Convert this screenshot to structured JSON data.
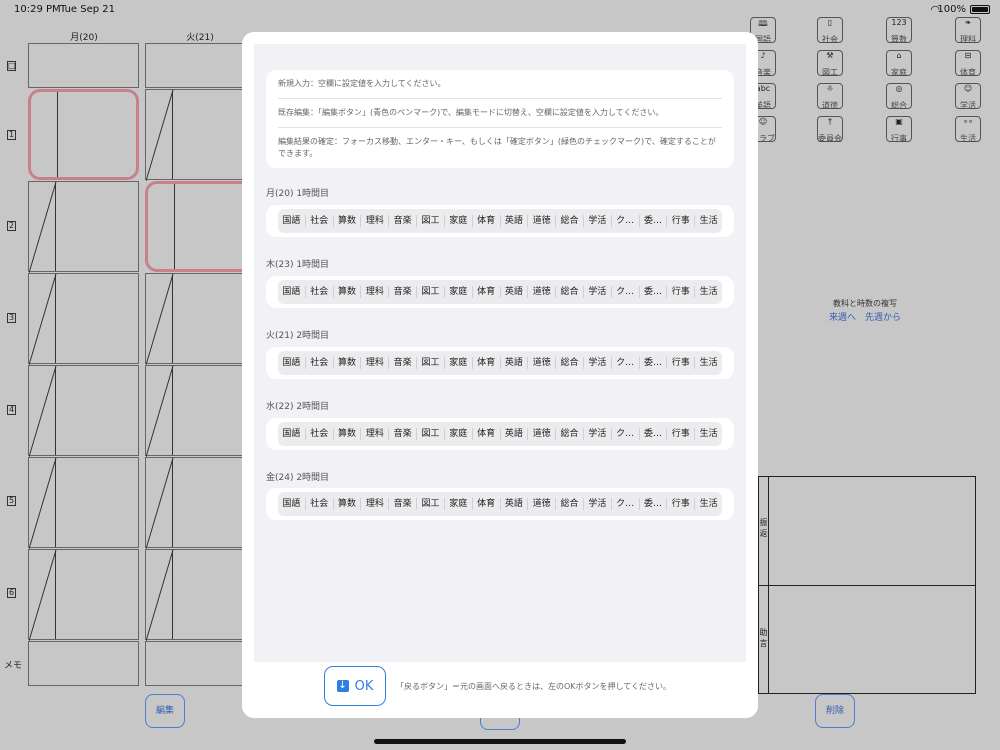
{
  "status": {
    "time": "10:29 PM",
    "date": "Tue Sep 21",
    "battery": "100%"
  },
  "days": [
    "月(20)",
    "火(21)"
  ],
  "row_labels": [
    "□",
    "1",
    "2",
    "3",
    "4",
    "5",
    "6"
  ],
  "memo_label": "メモ",
  "bottom_buttons": {
    "edit": "編集",
    "delete": "削除"
  },
  "subjects_panel": [
    {
      "label": "国語",
      "icon": "book-icon"
    },
    {
      "label": "社会",
      "icon": "map-icon"
    },
    {
      "label": "算数",
      "icon": "123"
    },
    {
      "label": "理科",
      "icon": "leaf-icon"
    },
    {
      "label": "音楽",
      "icon": "music-icon"
    },
    {
      "label": "図工",
      "icon": "hammer-icon"
    },
    {
      "label": "家庭",
      "icon": "house-icon"
    },
    {
      "label": "体育",
      "icon": "field-icon"
    },
    {
      "label": "英語",
      "icon": "abc"
    },
    {
      "label": "道徳",
      "icon": "sun-icon"
    },
    {
      "label": "総合",
      "icon": "globe-icon"
    },
    {
      "label": "学活",
      "icon": "people-icon"
    },
    {
      "label": "クラブ",
      "icon": "smile-icon"
    },
    {
      "label": "委員会",
      "icon": "person-icon"
    },
    {
      "label": "行事",
      "icon": "camera-icon"
    },
    {
      "label": "生活",
      "icon": "bicycle-icon"
    }
  ],
  "copy_panel": {
    "label": "教科と時数の複写",
    "next_week": "来週へ",
    "prev_week": "先週から"
  },
  "right_grid": {
    "label1": "振返",
    "label2": "助言"
  },
  "modal": {
    "instructions": [
      "新規入力：空欄に設定値を入力してください。",
      "既存編集：「編集ボタン」(青色のペンマーク)で、編集モードに切替え、空欄に設定値を入力してください。",
      "編集結果の確定：フォーカス移動、エンター・キー、もしくは「確定ボタン」(緑色のチェックマーク)で、確定することができます。"
    ],
    "sections": [
      {
        "title": "月(20) 1時間目"
      },
      {
        "title": "木(23) 1時間目"
      },
      {
        "title": "火(21) 2時間目"
      },
      {
        "title": "水(22) 2時間目"
      },
      {
        "title": "金(24) 2時間目"
      }
    ],
    "chips": [
      "国語",
      "社会",
      "算数",
      "理科",
      "音楽",
      "図工",
      "家庭",
      "体育",
      "英語",
      "道徳",
      "総合",
      "学活",
      "ク…",
      "委…",
      "行事",
      "生活"
    ],
    "ok_label": "OK",
    "footer_note": "「戻るボタン」＝元の画面へ戻るときは、左のOKボタンを押してください。"
  }
}
